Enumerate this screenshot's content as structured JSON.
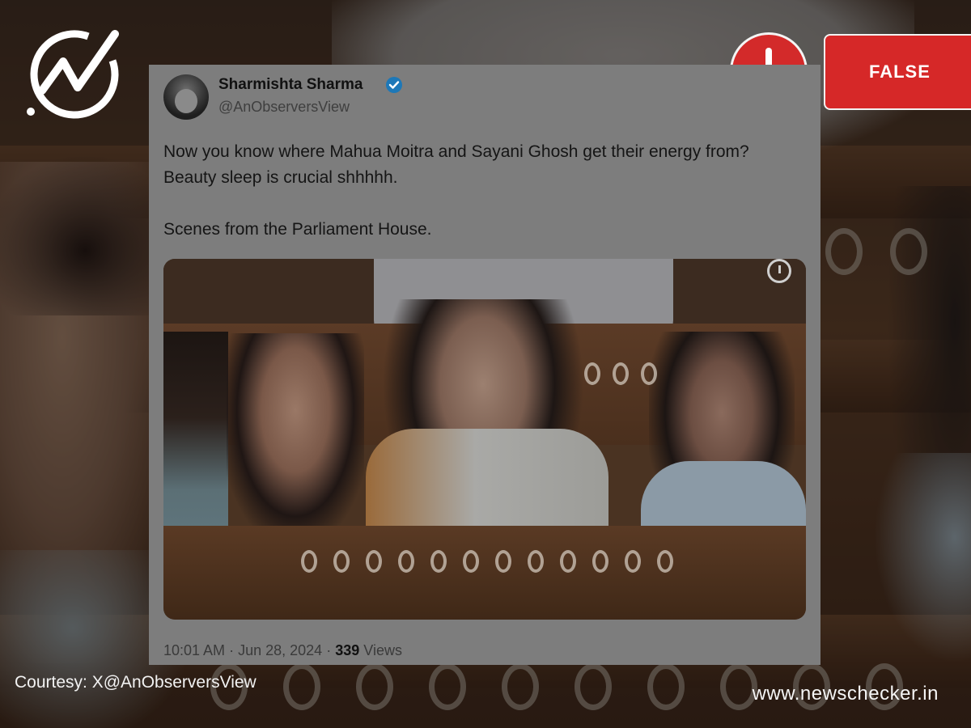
{
  "badge": {
    "label": "FALSE",
    "color": "#d62828"
  },
  "tweet": {
    "author_name": "Sharmishta Sharma",
    "author_handle": "@AnObserversView",
    "text": "Now you know where Mahua Moitra and Sayani Ghosh get their energy from? Beauty sleep is crucial shhhhh.\n\nScenes from the Parliament House.",
    "time": "10:01 AM",
    "separator": "·",
    "date": "Jun 28, 2024",
    "separator2": "·",
    "views_count": "339",
    "views_label": "Views"
  },
  "footer": {
    "courtesy": "Courtesy: X@AnObserversView",
    "site_url": "www.newschecker.in"
  },
  "icons": {
    "logo": "newschecker-logo-icon",
    "alert": "exclamation-icon",
    "verified": "verified-badge-icon",
    "clock": "clock-icon"
  }
}
